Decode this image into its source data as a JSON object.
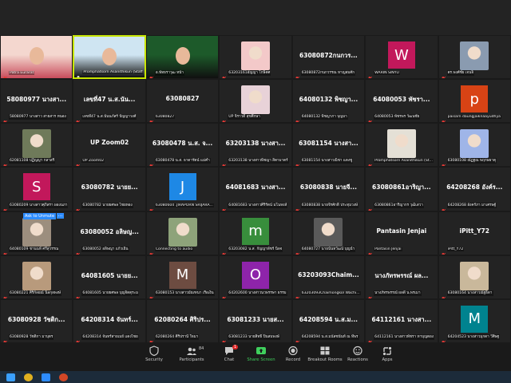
{
  "tiles": [
    {
      "type": "video",
      "colors": [
        "#f4d7cf",
        "#c94c5b"
      ],
      "label": "Patra Eurarat",
      "active": false,
      "mic": "off"
    },
    {
      "type": "video",
      "colors": [
        "#cfe5f2",
        "#111111"
      ],
      "label": "Promphatsorn Asanithikun (Staff)",
      "active": true,
      "mic": "on"
    },
    {
      "type": "video",
      "colors": [
        "#1d5a2a",
        "#101010"
      ],
      "label": "อ.พัทธราวุฒ หน้า",
      "active": false,
      "mic": "off"
    },
    {
      "type": "photo",
      "color": "#f3c9c9",
      "label": "63203161อัญญา โกษิตศ",
      "mic": "off"
    },
    {
      "type": "name",
      "name": "63080872กนกวร...",
      "label": "63080872กนกวรรณ หาญสมศัก",
      "mic": "off"
    },
    {
      "type": "avatar",
      "letter": "W",
      "color": "#c2185b",
      "label": "WARIN SINYU",
      "mic": "off"
    },
    {
      "type": "photo",
      "color": "#8a9bb0",
      "label": "ดร.พงศ์ชัย เจนจิ",
      "mic": "off"
    },
    {
      "type": "name",
      "name": "58080977 นางสา...",
      "label": "58080977 นางสาว สายสาร หนอง",
      "mic": "off"
    },
    {
      "type": "name",
      "name": "เลขที่47 น.ส.นัน...",
      "label": "เลขที่47 น.ส.นันนภัสร์ ปัญญาวงศ์",
      "mic": "off"
    },
    {
      "type": "name",
      "name": "63080827",
      "label": "63080827",
      "mic": "off"
    },
    {
      "type": "photo",
      "color": "#e8d2d8",
      "label": "UP จิราวดี สุขศึกษา",
      "mic": "off"
    },
    {
      "type": "name",
      "name": "64080132 พิชญา...",
      "label": "64080132 พิชญาภา บุญมา",
      "mic": "off"
    },
    {
      "type": "name",
      "name": "64080053 พัชรา...",
      "label": "64080053 พัชรพร วัฒนชัย",
      "mic": "off"
    },
    {
      "type": "avatar",
      "letter": "p",
      "color": "#d84315",
      "label": "paisarn daungjaiknaayudhya",
      "mic": "off"
    },
    {
      "type": "photo",
      "color": "#6f7a5a",
      "label": "62081108 ปฏิญญา กลาสรี",
      "mic": "off"
    },
    {
      "type": "name",
      "name": "UP Zoom02",
      "label": "UP Zoom02",
      "mic": "off"
    },
    {
      "type": "name",
      "name": "63080478 น.ส. จ...",
      "label": "63080478 น.ส. ธาดารัตน์ แม่คำ",
      "mic": "off"
    },
    {
      "type": "name",
      "name": "63203138 นางสา...",
      "label": "63203138 นางสาวพิชญา สิตามาตร์",
      "mic": "off"
    },
    {
      "type": "name",
      "name": "63081154 นางสา...",
      "label": "63081154 นางสาวณิชา แดงชู",
      "mic": "off"
    },
    {
      "type": "photo",
      "color": "#e4e0d6",
      "label": "Promphatsorn Asanithikun (St...",
      "mic": "off"
    },
    {
      "type": "photo",
      "color": "#9fb5e8",
      "label": "63080108 ณัฏฐณ พฤกษธาตุ",
      "mic": "off"
    },
    {
      "type": "avatar",
      "letter": "S",
      "color": "#c2185b",
      "label": "63080209 นางสาวศุภิสรา ผองนภา",
      "mic": "off"
    },
    {
      "type": "name",
      "name": "63080782 นายย...",
      "label": "63080782 นายยศพล ไชยทอง",
      "mic": "off"
    },
    {
      "type": "avatar",
      "letter": "J",
      "color": "#1e88e5",
      "label": "63080604 .JIRAPORN SRIJARA...",
      "mic": "off"
    },
    {
      "type": "name",
      "name": "64081683 นางสา...",
      "label": "64081683 นางสาวศิริรัตน์ มโนหงส์",
      "mic": "off"
    },
    {
      "type": "name",
      "name": "63080838 นายจี...",
      "label": "63080838 นายจีรศักดิ์ ประทุมวงษ์",
      "mic": "off"
    },
    {
      "type": "name",
      "name": "63080861อาริญา...",
      "label": "63080861อาริญากร วุฒิเสวา",
      "mic": "off"
    },
    {
      "type": "name",
      "name": "64208268 อังค์ร...",
      "label": "64208268 อังคร์ภา มาเศรษฐ์",
      "mic": "off"
    },
    {
      "type": "photo",
      "color": "#9c8e7e",
      "label": "64080109 ชานนท์ ศรีสุวรรณ",
      "mic": "off",
      "unmute": "Ask to Unmute"
    },
    {
      "type": "name",
      "name": "63080052 อลิษญ...",
      "label": "63080052 อลิษญา แก้วเย็น",
      "mic": "off"
    },
    {
      "type": "photo",
      "color": "#8ea37a",
      "label": "Connecting to audio",
      "mic": "off"
    },
    {
      "type": "avatar",
      "letter": "m",
      "color": "#388e3c",
      "label": "63203082 น.ส. กัญญาพัชร์ นิลจ",
      "mic": "off"
    },
    {
      "type": "photo",
      "color": "#5a5a5a",
      "label": "64080727 นายนั้นทวัฒน์ บุญนำ",
      "mic": "off"
    },
    {
      "type": "name",
      "name": "Pantasin Jenjai",
      "label": "Pantasin Jenjai",
      "mic": "off"
    },
    {
      "type": "name",
      "name": "iPitt_Y72",
      "label": "iPitt_Y72",
      "mic": "off"
    },
    {
      "type": "photo",
      "color": "#b89a7c",
      "label": "63080221 ศิริกัลยณ์ นิลกุลพงษ์",
      "mic": "off"
    },
    {
      "type": "name",
      "name": "64081605 นายย...",
      "label": "64081605 นายยศพล บุญจิตตุระม",
      "mic": "off"
    },
    {
      "type": "avatar",
      "letter": "M",
      "color": "#6d4c41",
      "label": "63080153 นางสาวมัณฑนา เรือเงิน",
      "mic": "off"
    },
    {
      "type": "avatar",
      "letter": "O",
      "color": "#8e24aa",
      "label": "64202600 นางสาวนวพรรษา ธรรม",
      "mic": "off"
    },
    {
      "type": "name",
      "name": "63203093Chaim...",
      "label": "63203093Chaimongkol Wachi...",
      "mic": "off"
    },
    {
      "type": "name",
      "name": "นางภัทรพรรณ์ ผล...",
      "label": "นางภัทรพรรณ์ ผลดี น.พรเมา",
      "mic": "off"
    },
    {
      "type": "photo",
      "color": "#c9b89b",
      "label": "63080164 นางสาวณัฐธิดา",
      "mic": "off"
    },
    {
      "type": "name",
      "name": "63080928 วัชติก...",
      "label": "63080928 วัชติกา มาบุตร",
      "mic": "off"
    },
    {
      "type": "name",
      "name": "64208314 จันทร์...",
      "label": "64208314 จันทร์สายเมย์ แดงไชย",
      "mic": "off"
    },
    {
      "type": "name",
      "name": "62080264 ศิริปร...",
      "label": "62080264 ศิริปรานี ใจมา",
      "mic": "off"
    },
    {
      "type": "name",
      "name": "63081233 นายส...",
      "label": "63081233 นายสิทธิ์ ปิ่นสมพงษ์",
      "mic": "off"
    },
    {
      "type": "name",
      "name": "64208594 น.ส.ม...",
      "label": "64208594 น.ส.มนัสชนันท์ ณ ทีพร",
      "mic": "off"
    },
    {
      "type": "name",
      "name": "64112161 นางสา...",
      "label": "64112161 นางสาวพัชรา ทาบุญตอง",
      "mic": "off"
    },
    {
      "type": "avatar",
      "letter": "M",
      "color": "#00838f",
      "label": "64204523 นางสาวมุกดา วีศิษฐ",
      "mic": "off"
    }
  ],
  "toolbar": {
    "participants_count": "84",
    "chat_badge": "1",
    "items": [
      {
        "label": "Security",
        "icon": "shield-icon",
        "color": "#cccccc"
      },
      {
        "label": "Participants",
        "icon": "participants-icon",
        "color": "#cccccc"
      },
      {
        "label": "Chat",
        "icon": "chat-icon",
        "color": "#cccccc"
      },
      {
        "label": "Share Screen",
        "icon": "share-screen-icon",
        "color": "#3fd05d"
      },
      {
        "label": "Record",
        "icon": "record-icon",
        "color": "#cccccc"
      },
      {
        "label": "Breakout Rooms",
        "icon": "breakout-rooms-icon",
        "color": "#cccccc"
      },
      {
        "label": "Reactions",
        "icon": "reactions-icon",
        "color": "#cccccc"
      },
      {
        "label": "Apps",
        "icon": "apps-icon",
        "color": "#cccccc"
      }
    ]
  },
  "taskbar": {
    "icons": [
      "windows-start-icon",
      "chrome-icon",
      "zoom-icon",
      "powerpoint-icon"
    ]
  }
}
